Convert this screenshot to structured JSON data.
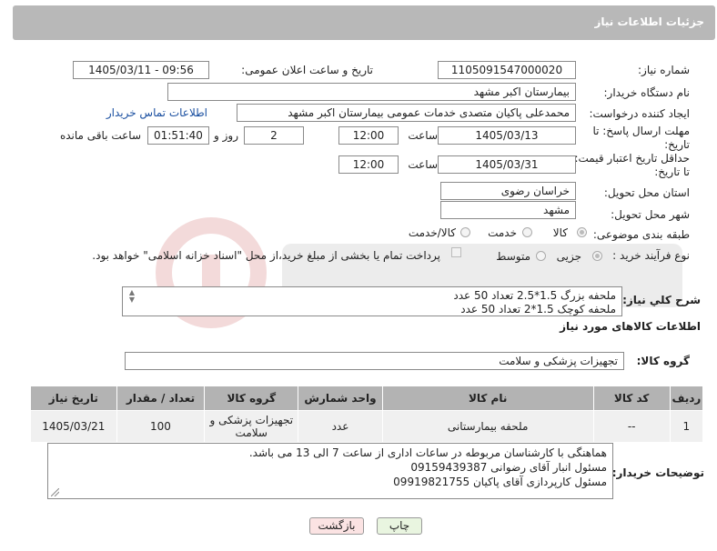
{
  "header": {
    "title": "جزئیات اطلاعات نیاز"
  },
  "form": {
    "need_number_label": "شماره نیاز:",
    "need_number": "1105091547000020",
    "announce_label": "تاریخ و ساعت اعلان عمومی:",
    "announce_value": "1405/03/11 - 09:56",
    "buyer_org_label": "نام دستگاه خریدار:",
    "buyer_org": "بیمارستان اکبر مشهد",
    "requester_label": "ایجاد کننده درخواست:",
    "requester": "محمدعلی پاکیان متصدی خدمات عمومی بیمارستان اکبر مشهد",
    "contact_link": "اطلاعات تماس خریدار",
    "deadline_label_1": "مهلت ارسال پاسخ: تا",
    "deadline_label_2": "تاریخ:",
    "deadline_date": "1405/03/13",
    "time_label": "ساعت",
    "deadline_time": "12:00",
    "days_value": "2",
    "days_label": "روز و",
    "remaining_time": "01:51:40",
    "remaining_label": "ساعت باقی مانده",
    "price_label_1": "حداقل تاریخ اعتبار قیمت:",
    "price_label_2": "تا تاریخ:",
    "price_date": "1405/03/31",
    "price_time": "12:00",
    "province_label": "استان محل تحویل:",
    "province": "خراسان رضوی",
    "city_label": "شهر محل تحویل:",
    "city": "مشهد",
    "category_label": "طبقه بندی موضوعی:",
    "category_options": [
      "کالا",
      "خدمت",
      "کالا/خدمت"
    ],
    "process_label": "نوع فرآیند خرید :",
    "process_options": [
      "جزیی",
      "متوسط"
    ],
    "payment_note": "پرداخت تمام یا بخشی از مبلغ خرید،از محل \"اسناد خزانه اسلامی\" خواهد بود.",
    "description_label": "شرح کلي نياز:",
    "description_lines": [
      "ملحفه بزرگ 1.5*2.5 تعداد 50 عدد",
      "ملحفه کوچک 1.5*2  تعداد 50 عدد"
    ],
    "goods_info_title": "اطلاعات کالاهای مورد نیاز",
    "goods_group_label": "گروه کالا:",
    "goods_group": "تجهیزات پزشکی و سلامت"
  },
  "table": {
    "headers": [
      "ردیف",
      "کد کالا",
      "نام کالا",
      "واحد شمارش",
      "گروه کالا",
      "تعداد / مقدار",
      "تاریخ نیاز"
    ],
    "rows": [
      [
        "1",
        "--",
        "ملحفه بیمارستانی",
        "عدد",
        "تجهیزات پزشکی و سلامت",
        "100",
        "1405/03/21"
      ]
    ]
  },
  "buyer_notes": {
    "label": "توضیحات خریدار:",
    "lines": [
      "هماهنگی با کارشناسان مربوطه در ساعات اداری از ساعت 7 الی 13 می باشد.",
      "مسئول انبار آقای رضوانی 09159439387",
      "مسئول کارپردازی آقای پاکیان 09919821755"
    ]
  },
  "buttons": {
    "print": "چاپ",
    "back": "بازگشت"
  },
  "colors": {
    "header_bg": "#b8b8b8",
    "link": "#1a4fa0",
    "print_bg": "#e9f5e0",
    "back_bg": "#fbe3e3"
  },
  "watermark": {
    "icon": "tender-logo-watermark"
  }
}
